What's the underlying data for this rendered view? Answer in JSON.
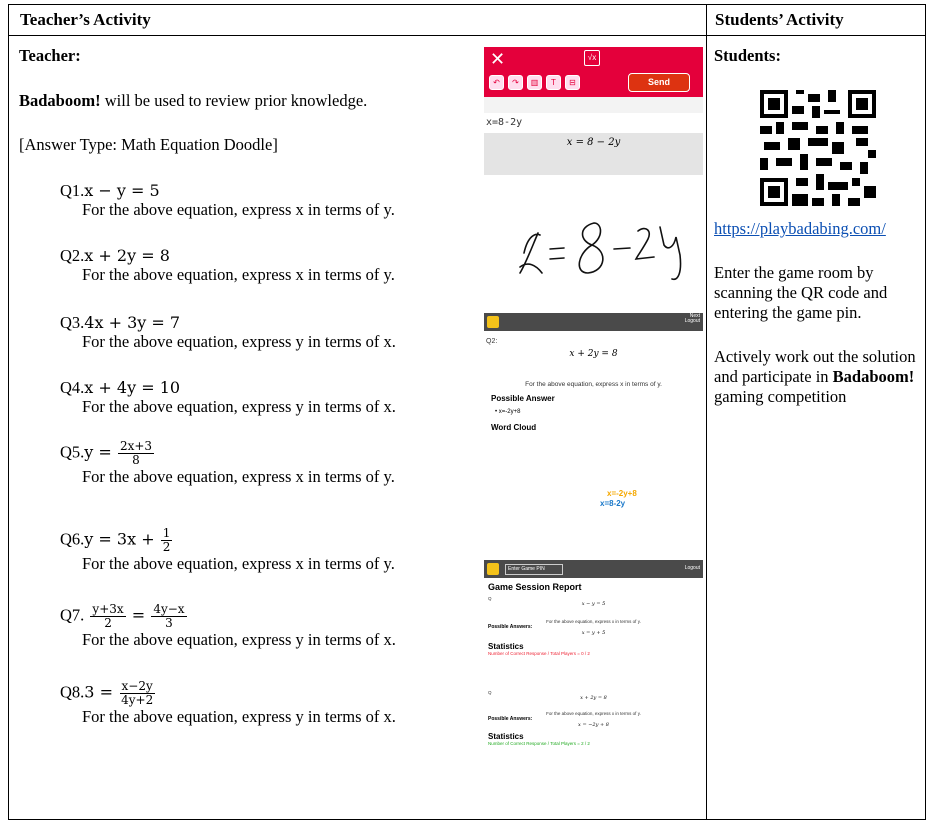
{
  "header": {
    "teacher_col": "Teacher’s Activity",
    "students_col": "Students’ Activity"
  },
  "teacher": {
    "label": "Teacher:",
    "intro_bold": "Badaboom!",
    "intro_rest": " will be used to review prior knowledge.",
    "answer_type": "[Answer Type: Math Equation Doodle]",
    "questions": [
      {
        "num": "Q1.",
        "equation": "x − y = 5",
        "text": "For the above equation, express x in terms of y."
      },
      {
        "num": "Q2.",
        "equation": "x + 2y = 8",
        "text": "For the above equation, express x in terms of y."
      },
      {
        "num": "Q3.",
        "equation": "4x + 3y = 7",
        "text": "For the above equation, express y in terms of x."
      },
      {
        "num": "Q4.",
        "equation": "x + 4y = 10",
        "text": "For the above equation, express y in terms of x."
      },
      {
        "num": "Q5.",
        "lhs": "y =",
        "frac_num": "2x+3",
        "frac_den": "8",
        "text": "For the above equation, express x in terms of y."
      },
      {
        "num": "Q6.",
        "lhs": "y = 3x +",
        "frac_num": "1",
        "frac_den": "2",
        "text": "For the above equation, express x in terms of y."
      },
      {
        "num": "Q7.",
        "frac1_num": "y+3x",
        "frac1_den": "2",
        "eq": "=",
        "frac2_num": "4y−x",
        "frac2_den": "3",
        "text": "For the above equation, express y in terms of x."
      },
      {
        "num": "Q8.",
        "lhs": "3 =",
        "frac_num": "x−2y",
        "frac_den": "4y+2",
        "text": "For the above equation, express y in terms of x."
      }
    ]
  },
  "app1": {
    "send_label": "Send",
    "input_text": "x=8-2y",
    "rendered": "x = 8 − 2y",
    "handwriting": "x = 8 - 2y",
    "brand_color": "#e4003b"
  },
  "app2": {
    "next_label": "Next",
    "logout_label": "Logout",
    "q_label": "Q2:",
    "math": "x + 2y = 8",
    "prompt": "For the above equation, express x in terms of y.",
    "possible_answer": "Possible Answer",
    "answer_item": "• x=-2y+8",
    "word_cloud": "Word Cloud",
    "wc_word1": "x=-2y+8",
    "wc_word2": "x=8-2y"
  },
  "app3": {
    "pin_placeholder": "Enter Game PIN",
    "logout_label": "Logout",
    "title": "Game Session Report",
    "q_label": "Q",
    "math1": "x − y = 5",
    "prompt1": "For the above equation, express x in terms of y.",
    "possible_answers": "Possible Answers:",
    "answer1": "x = y + 5",
    "statistics": "Statistics",
    "stat1": "Number of Correct Response / Total Players = 0 / 2",
    "q2_label": "Q",
    "math2": "x + 2y = 8",
    "prompt2": "For the above equation, express x in terms of y.",
    "answer2": "x = −2y + 8",
    "stat2": "Number of Correct Response / Total Players = 2 / 2"
  },
  "students": {
    "label": "Students:",
    "link": "https://playbadabing.com/",
    "para1": "Enter the game room by scanning the QR code and entering the game pin.",
    "para2": "Actively work out the solution and participate in",
    "para2_bold": "Badaboom!",
    "para2_rest": " gaming competition"
  }
}
